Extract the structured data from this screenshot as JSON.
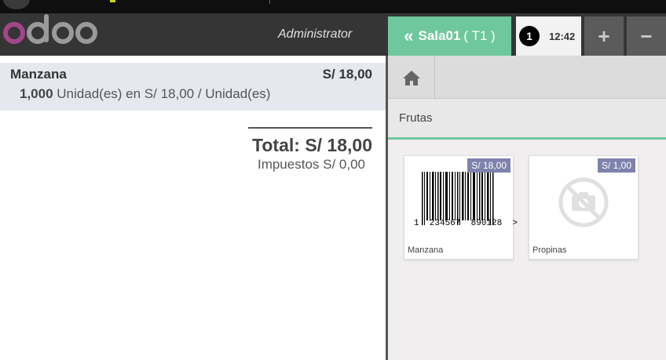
{
  "header": {
    "logo_text": "odoo",
    "user": "Administrator",
    "order_tab": {
      "label": "Sala01",
      "table": "( T1 )"
    },
    "order_selector": {
      "number": "1",
      "time": "12:42"
    },
    "buttons": {
      "plus": "+",
      "minus": "−"
    }
  },
  "orderline": {
    "product": "Manzana",
    "price": "S/ 18,00",
    "quantity": "1,000",
    "unit_text": "Unidad(es) en S/ 18,00 / Unidad(es)"
  },
  "summary": {
    "total": "Total: S/ 18,00",
    "taxes": "Impuestos S/ 0,00"
  },
  "category_bar": {
    "category": "Frutas"
  },
  "products": [
    {
      "name": "Manzana",
      "price": "S/ 18,00",
      "barcode_text": "1  234567  890128  >"
    },
    {
      "name": "Propinas",
      "price": "S/ 1,00"
    }
  ],
  "colors": {
    "accent": "#6ec89b",
    "header": "#353535",
    "price_tag": "#7f82ac",
    "selected_line": "#e6e8f0"
  },
  "icons": [
    "home-icon",
    "no-image-icon",
    "chevrons-left-icon"
  ]
}
